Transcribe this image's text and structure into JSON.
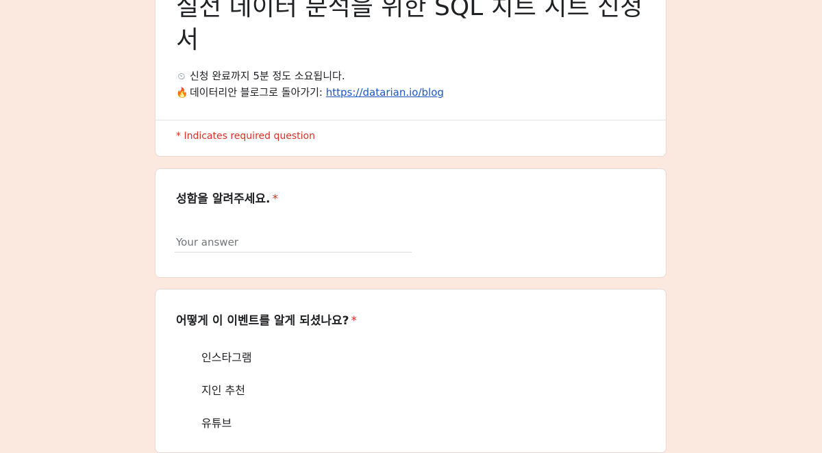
{
  "form": {
    "title": "실전 데이터 분석을 위한 SQL 치트 시트 신청서",
    "description": {
      "line1_emoji": "⏲",
      "line1_text": "신청 완료까지 5분 정도 소요됩니다.",
      "line2_emoji": "🔥",
      "line2_text": "데이터리안 블로그로 돌아가기: ",
      "line2_link": "https://datarian.io/blog"
    },
    "required_note": "* Indicates required question"
  },
  "questions": [
    {
      "title": "성함을 알려주세요.",
      "required_mark": "*",
      "placeholder": "Your answer"
    },
    {
      "title": "어떻게 이 이벤트를 알게 되셨나요?",
      "required_mark": "*",
      "options": [
        "인스타그램",
        "지인 추천",
        "유튜브"
      ]
    }
  ],
  "colors": {
    "page_background": "#fbe9e0",
    "card_background": "#ffffff",
    "required": "#d93025",
    "link": "#1a56c5"
  }
}
